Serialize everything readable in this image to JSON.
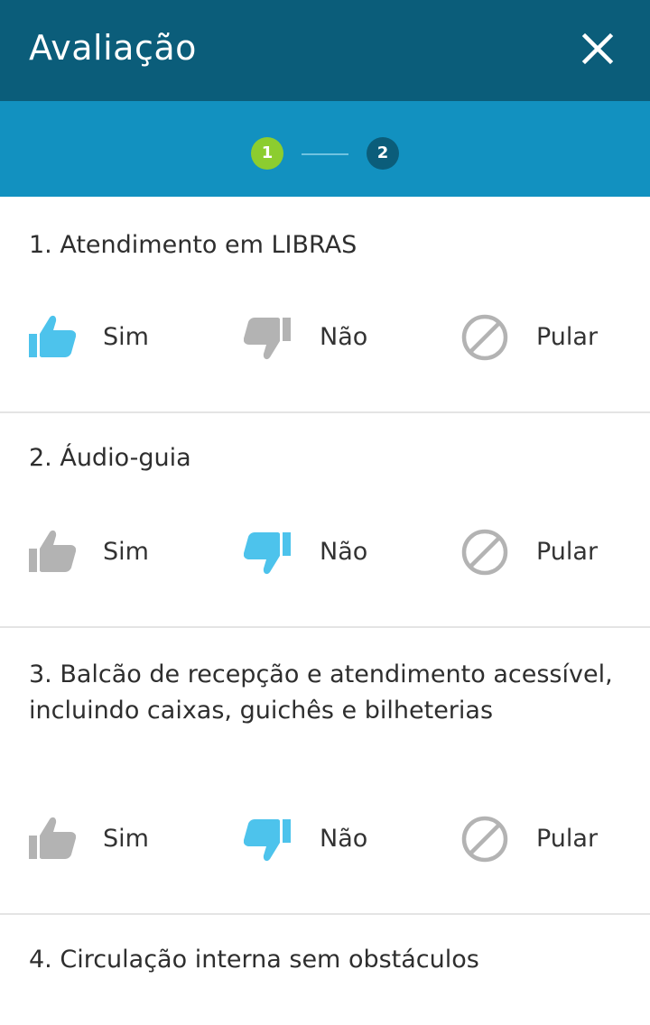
{
  "header": {
    "title": "Avaliação",
    "close_icon": "close-icon"
  },
  "stepper": {
    "steps": [
      "1",
      "2"
    ],
    "active_step": 1,
    "colors": {
      "active": "#8ccd2f",
      "inactive": "#0b5d7a"
    }
  },
  "colors": {
    "app_bar": "#0b5d7a",
    "stepper_bar": "#1291c0",
    "selected_icon": "#4dc3ec",
    "unselected_icon": "#b3b3b3"
  },
  "questions": [
    {
      "title": "1. Atendimento em LIBRAS",
      "selected": "sim",
      "options": {
        "sim": "Sim",
        "nao": "Não",
        "pular": "Pular"
      }
    },
    {
      "title": "2. Áudio-guia",
      "selected": "nao",
      "options": {
        "sim": "Sim",
        "nao": "Não",
        "pular": "Pular"
      }
    },
    {
      "title": "3. Balcão de recepção e atendimento acessível, incluindo caixas, guichês e bilheterias",
      "selected": "nao",
      "options": {
        "sim": "Sim",
        "nao": "Não",
        "pular": "Pular"
      }
    },
    {
      "title": "4. Circulação interna sem obstáculos"
    }
  ]
}
